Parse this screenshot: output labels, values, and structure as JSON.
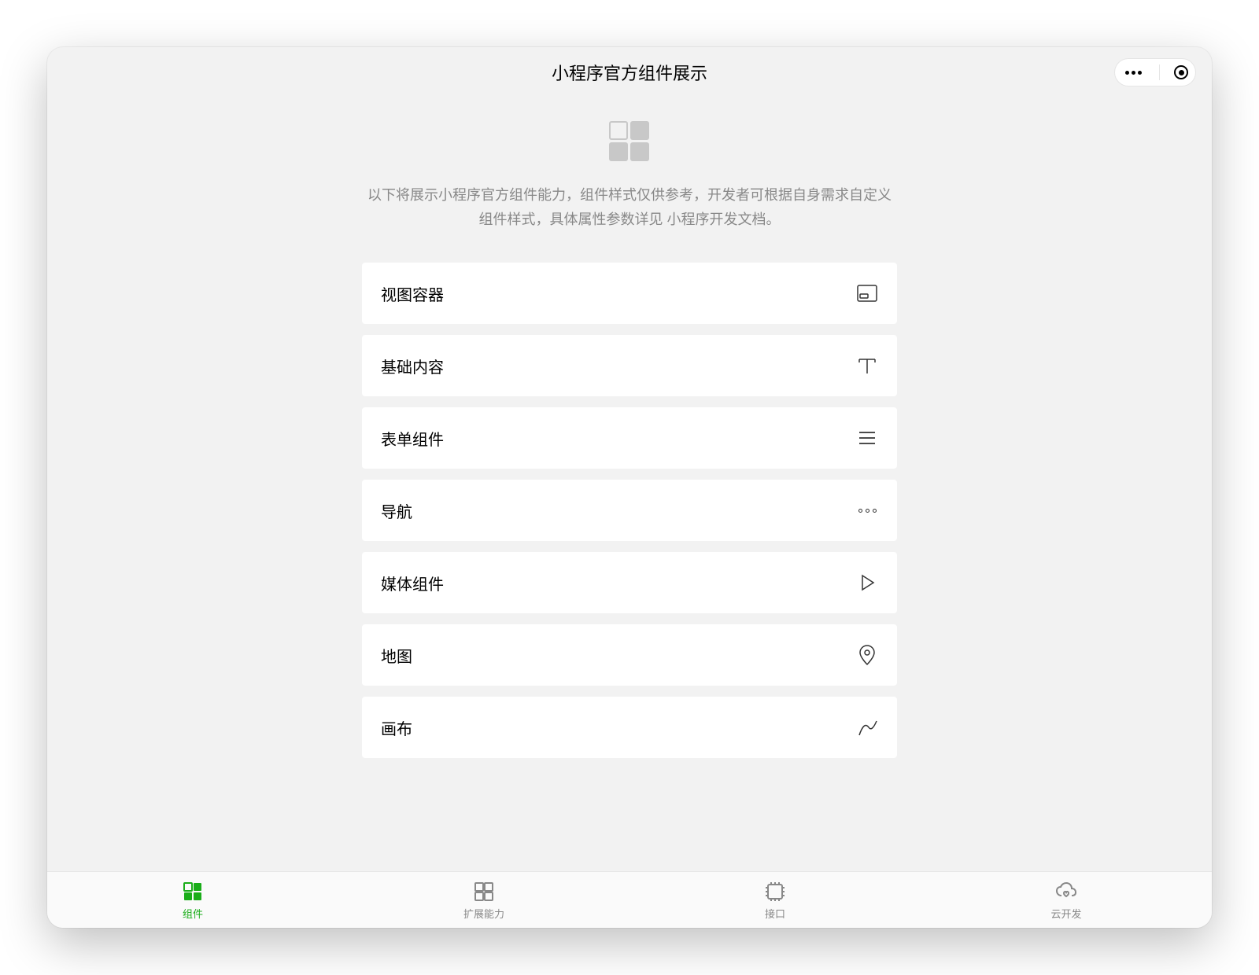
{
  "header": {
    "title": "小程序官方组件展示"
  },
  "intro": {
    "text_prefix": "以下将展示小程序官方组件能力，组件样式仅供参考，开发者可根据自身需求自定义组件样式，具体属性参数详见 ",
    "link_text": "小程序开发文档",
    "text_suffix": "。"
  },
  "list": {
    "items": [
      {
        "label": "视图容器",
        "icon": "view-container"
      },
      {
        "label": "基础内容",
        "icon": "text"
      },
      {
        "label": "表单组件",
        "icon": "form"
      },
      {
        "label": "导航",
        "icon": "nav"
      },
      {
        "label": "媒体组件",
        "icon": "media"
      },
      {
        "label": "地图",
        "icon": "map"
      },
      {
        "label": "画布",
        "icon": "canvas"
      }
    ]
  },
  "tabbar": {
    "items": [
      {
        "label": "组件",
        "icon": "component",
        "active": true
      },
      {
        "label": "扩展能力",
        "icon": "extension",
        "active": false
      },
      {
        "label": "接口",
        "icon": "api",
        "active": false
      },
      {
        "label": "云开发",
        "icon": "cloud",
        "active": false
      }
    ]
  }
}
